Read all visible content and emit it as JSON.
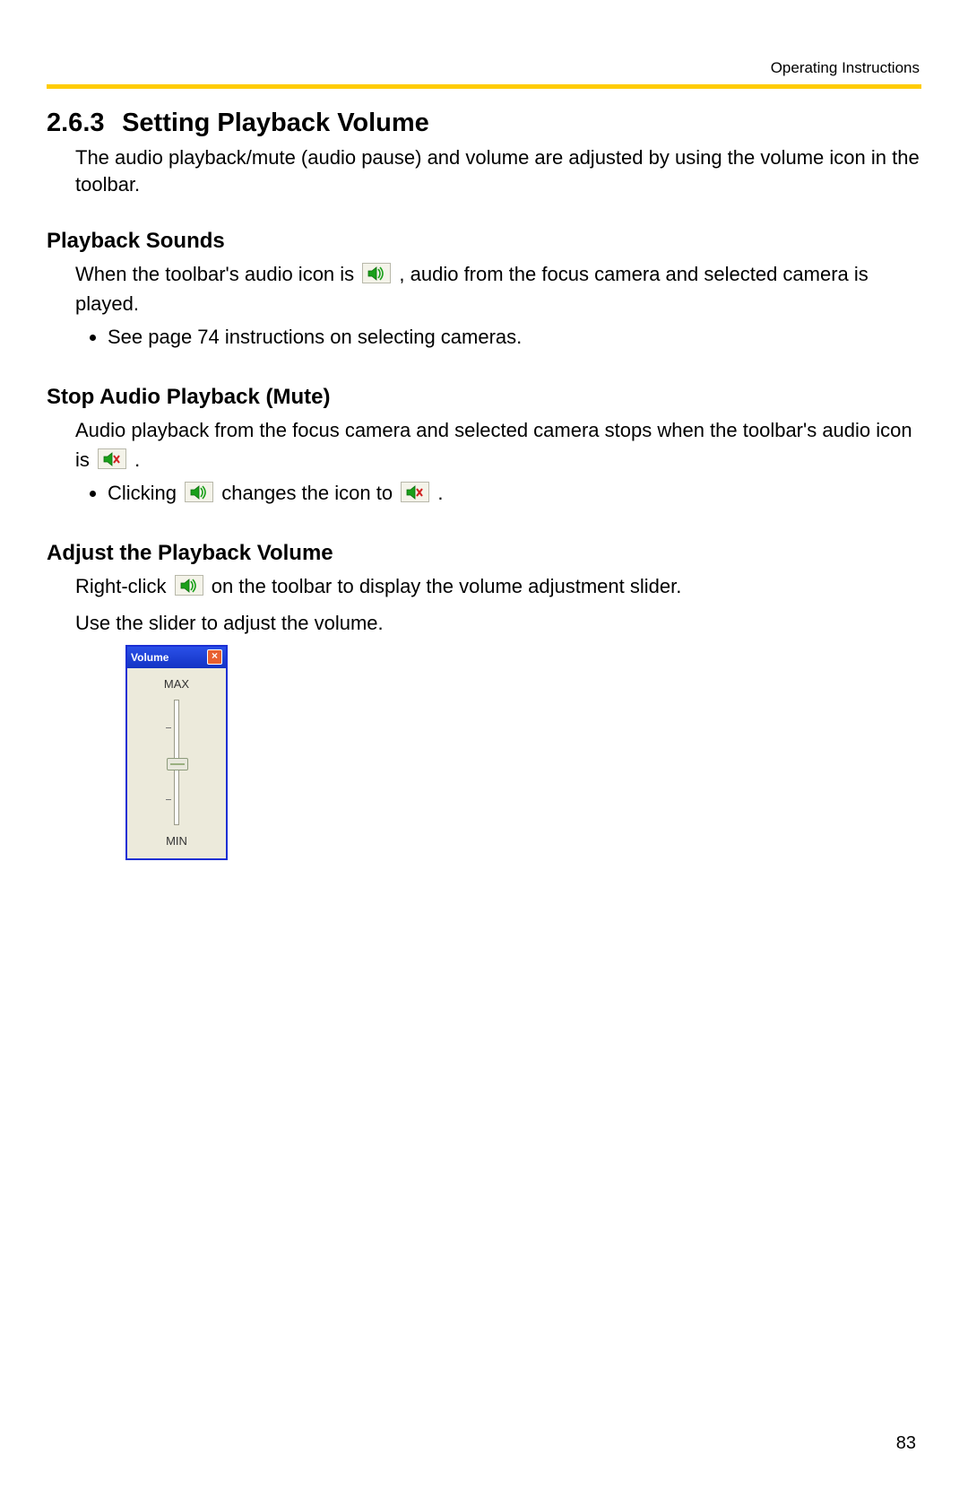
{
  "header": {
    "running": "Operating Instructions"
  },
  "section": {
    "number": "2.6.3",
    "title": "Setting Playback Volume",
    "intro": "The audio playback/mute (audio pause) and volume are adjusted by using the volume icon in the toolbar."
  },
  "playback_sounds": {
    "heading": "Playback Sounds",
    "line_a": "When the toolbar's audio icon is ",
    "line_b": " , audio from the focus camera and selected camera is played.",
    "bullet1": "See page 74 instructions on selecting cameras."
  },
  "stop_audio": {
    "heading": "Stop Audio Playback (Mute)",
    "line_a": "Audio playback from the focus camera and selected camera stops when the toolbar's audio icon is ",
    "period": " .",
    "bullet_a": "Clicking ",
    "bullet_b": " changes the icon to ",
    "bullet_c": " ."
  },
  "adjust_volume": {
    "heading": "Adjust the Playback Volume",
    "line_a": "Right-click ",
    "line_b": " on the toolbar to display the volume adjustment slider.",
    "line2": "Use the slider to adjust the volume."
  },
  "volume_panel": {
    "title": "Volume",
    "max": "MAX",
    "min": "MIN"
  },
  "page_number": "83"
}
